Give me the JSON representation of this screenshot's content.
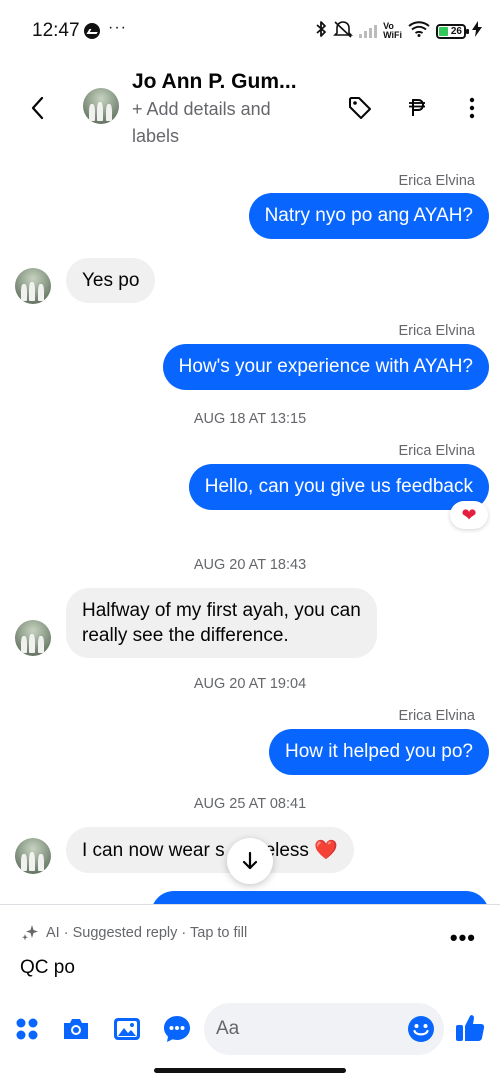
{
  "status_bar": {
    "time": "12:47",
    "more": "···",
    "battery": "26",
    "vo_top": "Vo",
    "vo_bottom": "WiFi"
  },
  "header": {
    "contact_name": "Jo Ann P. Gum...",
    "subtitle": "+ Add details and labels",
    "icons": [
      "back-chevron-icon",
      "tag-icon",
      "peso-icon",
      "more-vertical-icon"
    ]
  },
  "colors": {
    "outgoing_bubble": "#0866ff",
    "incoming_bubble": "#f0f0f0",
    "secondary_text": "#65676b",
    "reaction_heart": "#e41e3f"
  },
  "messages": [
    {
      "type": "outgoing",
      "sender": "Erica Elvina",
      "text": "Natry nyo po ang AYAH?"
    },
    {
      "type": "incoming",
      "text": "Yes po"
    },
    {
      "type": "outgoing",
      "sender": "Erica Elvina",
      "text": "How's your experience with AYAH?"
    },
    {
      "type": "timestamp",
      "text": "AUG 18 AT 13:15"
    },
    {
      "type": "outgoing",
      "sender": "Erica Elvina",
      "text": "Hello, can you give us feedback",
      "reaction": "❤"
    },
    {
      "type": "timestamp",
      "text": "AUG 20 AT 18:43"
    },
    {
      "type": "incoming",
      "text_line1": "Halfway of my first ayah, you can",
      "text_line2": "really see the difference."
    },
    {
      "type": "timestamp",
      "text": "AUG 20 AT 19:04"
    },
    {
      "type": "outgoing",
      "sender": "Erica Elvina",
      "text": "How it helped you po?"
    },
    {
      "type": "timestamp",
      "text": "AUG 25 AT 08:41"
    },
    {
      "type": "incoming",
      "text_start": "I can now wear s",
      "text_end": "eless",
      "emoji": "❤️"
    }
  ],
  "suggestion": {
    "ai_label": "AI · Suggested reply · Tap to fill",
    "reply_text": "QC po",
    "more": "•••"
  },
  "composer": {
    "placeholder": "Aa",
    "icons": [
      "apps-grid-icon",
      "camera-icon",
      "gallery-icon",
      "voice-clip-icon",
      "emoji-icon",
      "thumbs-up-icon"
    ]
  }
}
